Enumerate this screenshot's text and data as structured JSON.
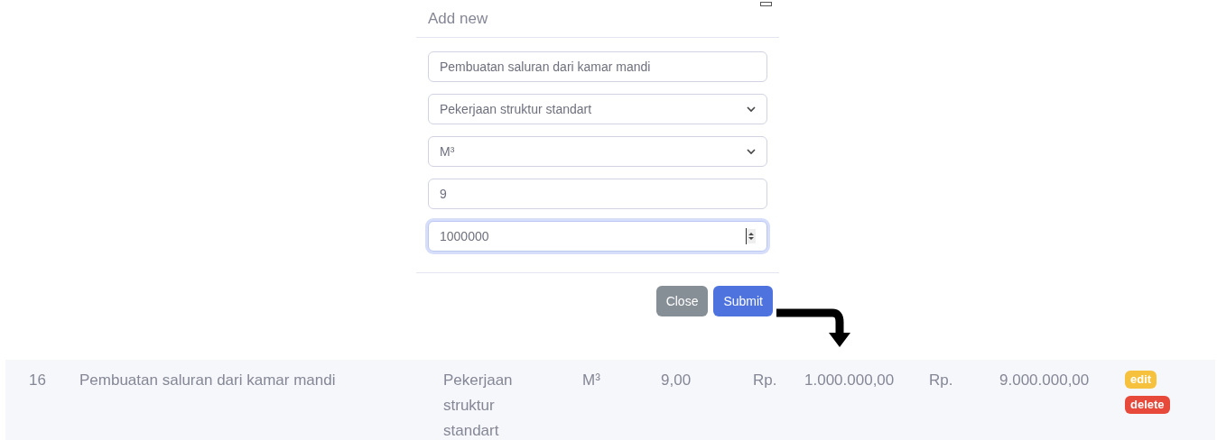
{
  "modal": {
    "title": "Add new",
    "fields": [
      {
        "kind": "text",
        "value": "Pembuatan saluran dari kamar mandi",
        "focused": false
      },
      {
        "kind": "select",
        "value": "Pekerjaan struktur standart",
        "focused": false
      },
      {
        "kind": "select",
        "value": "M³",
        "focused": false
      },
      {
        "kind": "text",
        "value": "9",
        "focused": false
      },
      {
        "kind": "number",
        "value": "1000000",
        "focused": true
      }
    ],
    "buttons": [
      {
        "label": "Close",
        "kind": "secondary"
      },
      {
        "label": "Submit",
        "kind": "primary"
      }
    ]
  },
  "table": {
    "rows": [
      {
        "cells": [
          "16",
          "Pembuatan saluran dari kamar mandi",
          "Pekerjaan struktur standart",
          "M³",
          "9,00",
          "Rp.",
          "1.000.000,00",
          "Rp.",
          "9.000.000,00"
        ],
        "actions": [
          {
            "label": "edit",
            "kind": "edit"
          },
          {
            "label": "delete",
            "kind": "delete"
          }
        ]
      }
    ]
  }
}
